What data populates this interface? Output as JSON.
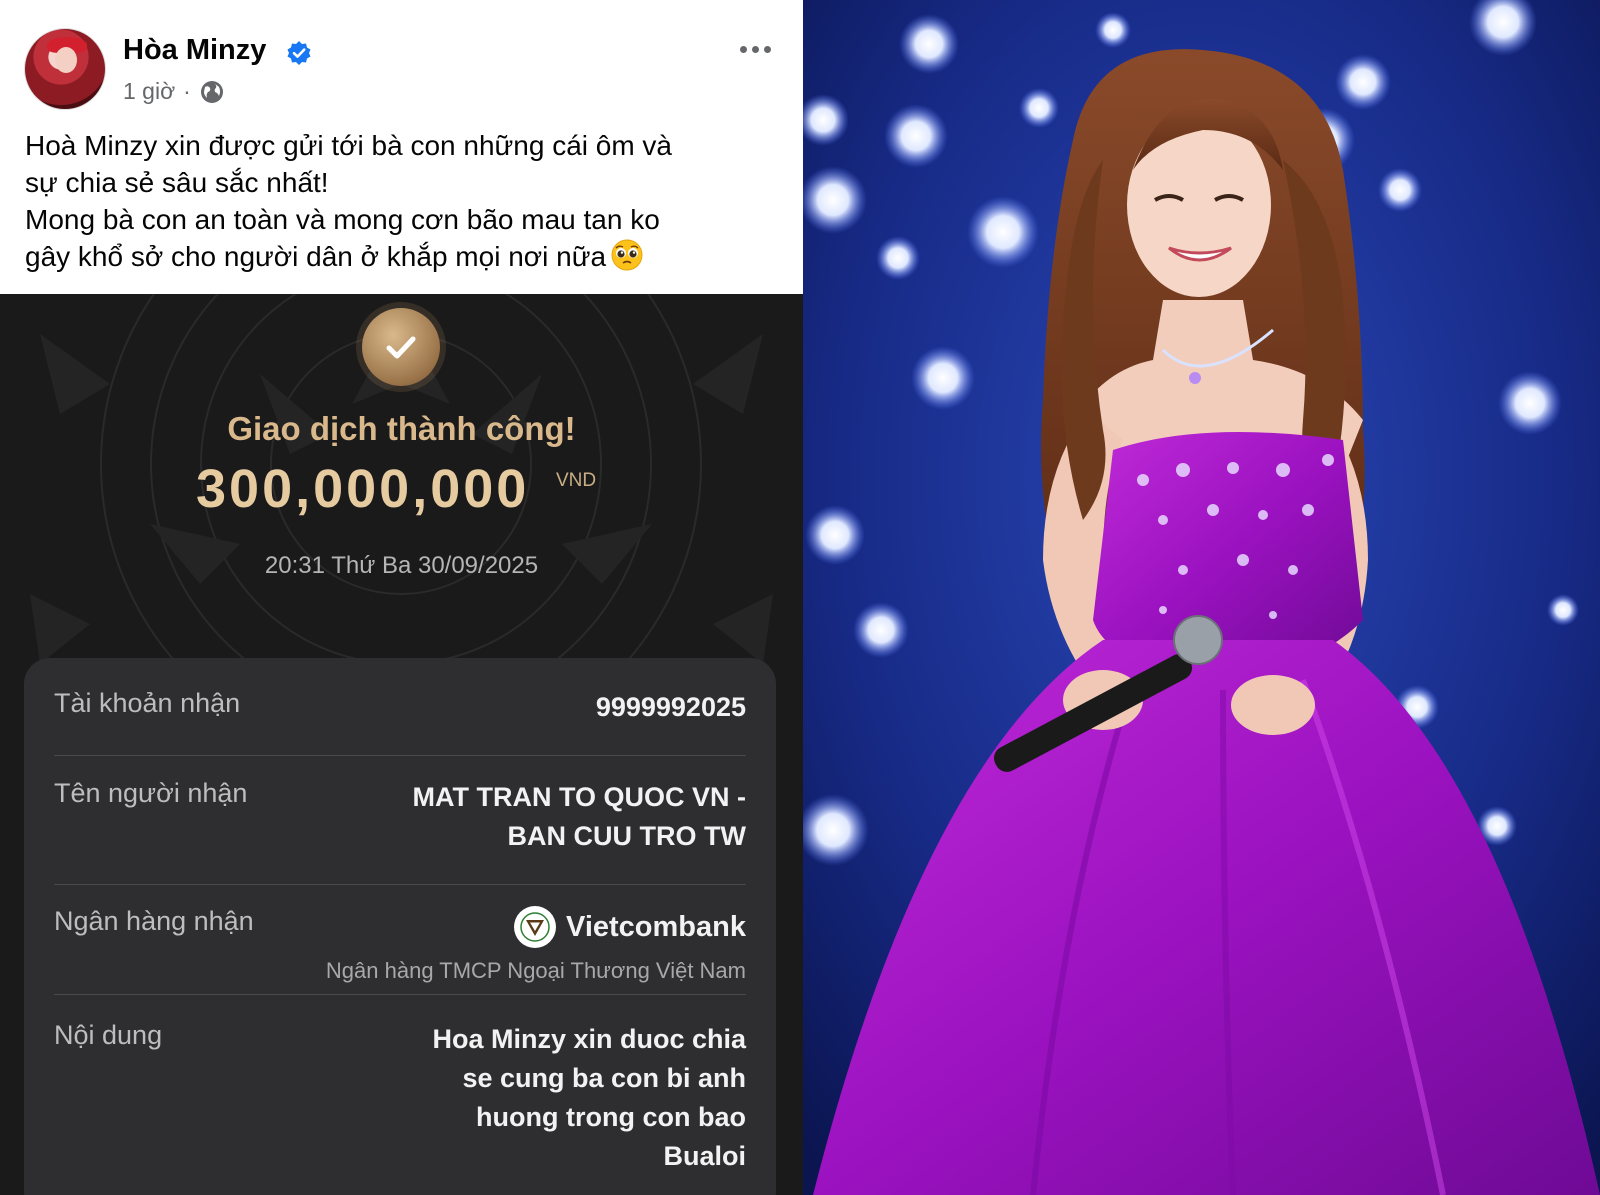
{
  "post": {
    "author": "Hòa Minzy",
    "time": "1 giờ",
    "separator": "·",
    "text_lines": [
      "Hoà Minzy xin được gửi tới bà con những cái ôm và",
      "sự chia sẻ sâu sắc nhất!",
      "Mong bà con an toàn và mong cơn bão mau tan ko",
      "gây khổ sở cho người dân ở khắp mọi nơi nữa"
    ],
    "icons": {
      "verified": "verified-badge-icon",
      "audience": "globe-icon",
      "menu": "more-options-icon",
      "emoji": "pleading-face-emoji"
    }
  },
  "receipt": {
    "title": "Giao dịch thành công!",
    "amount": "300,000,000",
    "currency": "VND",
    "datetime": "20:31 Thứ Ba 30/09/2025",
    "account_label": "Tài khoản nhận",
    "account_value": "9999992025",
    "recipient_label": "Tên người nhận",
    "recipient_lines": [
      "MAT TRAN TO QUOC VN -",
      "BAN CUU TRO TW"
    ],
    "bank_label": "Ngân hàng nhận",
    "bank_name": "Vietcombank",
    "bank_full_name": "Ngân hàng TMCP Ngoại Thương Việt Nam",
    "content_label": "Nội dung",
    "content_lines": [
      "Hoa Minzy xin duoc chia",
      "se cung ba con bi anh",
      "huong trong con bao",
      "Bualoi"
    ],
    "colors": {
      "background": "#1a1a1b",
      "card": "#2e2e30",
      "gold": "#d9b98c"
    }
  },
  "photo": {
    "colors": {
      "backdrop": "#1c2f8c",
      "gown": "#a418c4",
      "hair": "#7a3f22"
    }
  }
}
